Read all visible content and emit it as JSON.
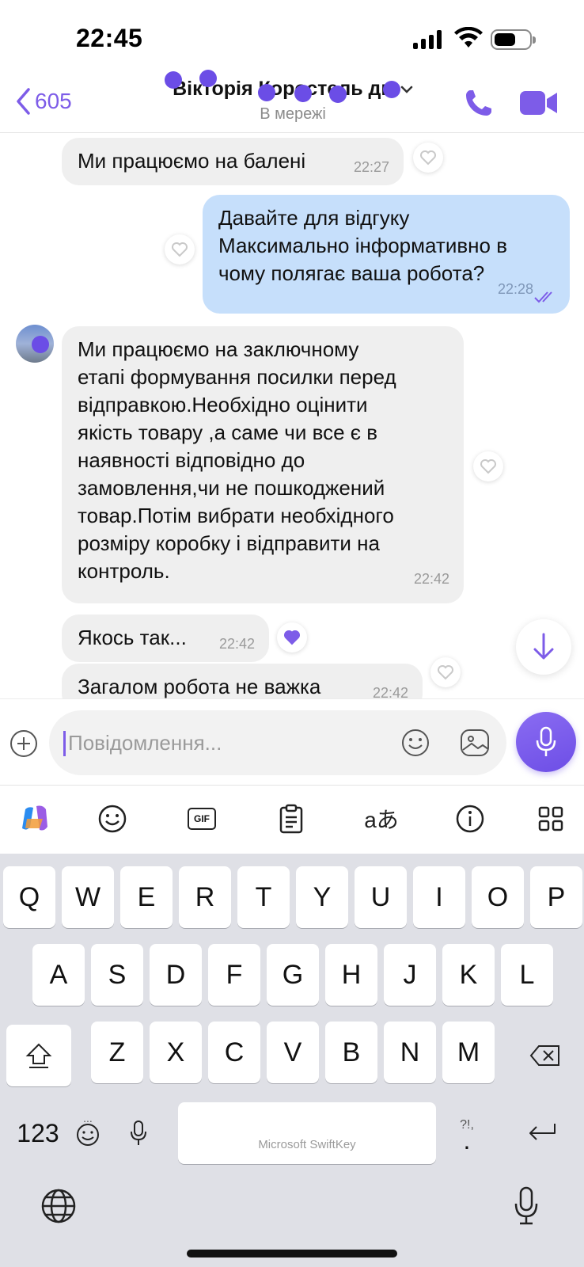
{
  "status_bar": {
    "time": "22:45",
    "battery_icon": "battery-icon",
    "wifi_icon": "wifi-icon",
    "signal_icon": "signal-icon"
  },
  "header": {
    "back_count": "605",
    "contact_name": "Вікторія Коростель дм",
    "contact_status": "В мережі",
    "accent_color": "#7d5ce8"
  },
  "messages": [
    {
      "direction": "in",
      "text": "Ми працюємо на балені",
      "time": "22:27",
      "liked": false
    },
    {
      "direction": "out",
      "text": "Давайте для відгуку\nМаксимально інформативно в\nчому полягає ваша робота?",
      "time": "22:28",
      "read": true,
      "liked": false
    },
    {
      "direction": "in",
      "text": "Ми працюємо на заключному\nетапі формування посилки перед\nвідправкою.Необхідно оцінити\nякість товару ,а саме чи все є в\nнаявності відповідно до\nзамовлення,чи не пошкоджений\nтовар.Потім вибрати необхідного\nрозміру коробку і відправити на\nконтроль.",
      "time": "22:42",
      "liked": false
    },
    {
      "direction": "in",
      "text": "Якось так...",
      "time": "22:42",
      "liked": true
    },
    {
      "direction": "in",
      "text": "Загалом робота не важка",
      "time": "22:42",
      "liked": false
    }
  ],
  "composer": {
    "placeholder": "Повідомлення..."
  },
  "keyboard": {
    "row1": [
      "Q",
      "W",
      "E",
      "R",
      "T",
      "Y",
      "U",
      "I",
      "O",
      "P"
    ],
    "row2": [
      "A",
      "S",
      "D",
      "F",
      "G",
      "H",
      "J",
      "K",
      "L"
    ],
    "row3": [
      "Z",
      "X",
      "C",
      "V",
      "B",
      "N",
      "M"
    ],
    "numbers_key": "123",
    "space_label": "Microsoft SwiftKey",
    "punct_hint": "?!,",
    "punct_key": ".",
    "emoji_hint": "...",
    "gif_label": "GIF",
    "translate_label": "aあ"
  }
}
